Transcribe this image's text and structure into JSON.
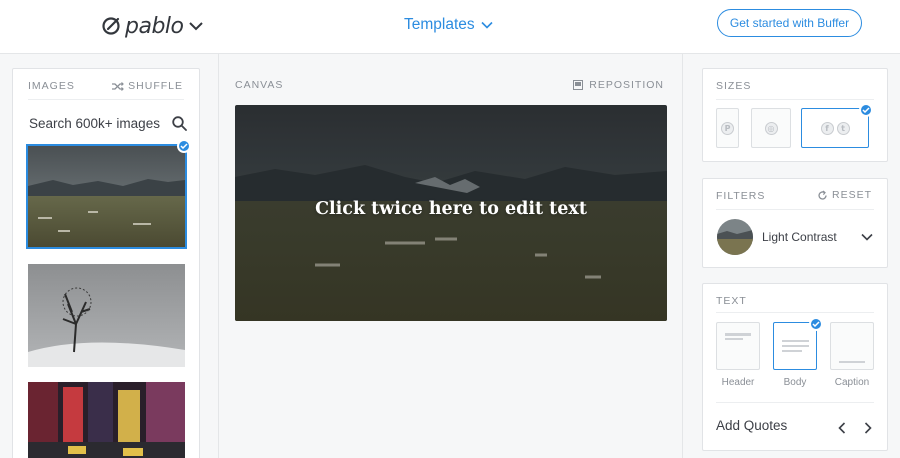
{
  "header": {
    "logo_text": "pablo",
    "templates_label": "Templates",
    "cta_label": "Get started with Buffer"
  },
  "images_panel": {
    "title": "IMAGES",
    "shuffle_label": "SHUFFLE",
    "search_placeholder": "Search 600k+ images"
  },
  "canvas": {
    "title": "CANVAS",
    "reposition_label": "REPOSITION",
    "overlay_text": "Click twice here to edit text"
  },
  "sizes": {
    "title": "SIZES"
  },
  "filters": {
    "title": "FILTERS",
    "reset_label": "RESET",
    "current": "Light Contrast"
  },
  "text_panel": {
    "title": "TEXT",
    "options": [
      "Header",
      "Body",
      "Caption"
    ],
    "selected": "Body",
    "add_quotes_label": "Add Quotes"
  },
  "colors": {
    "accent": "#2c8ce0",
    "muted_label": "#8a8f96",
    "text": "#3d4047"
  }
}
